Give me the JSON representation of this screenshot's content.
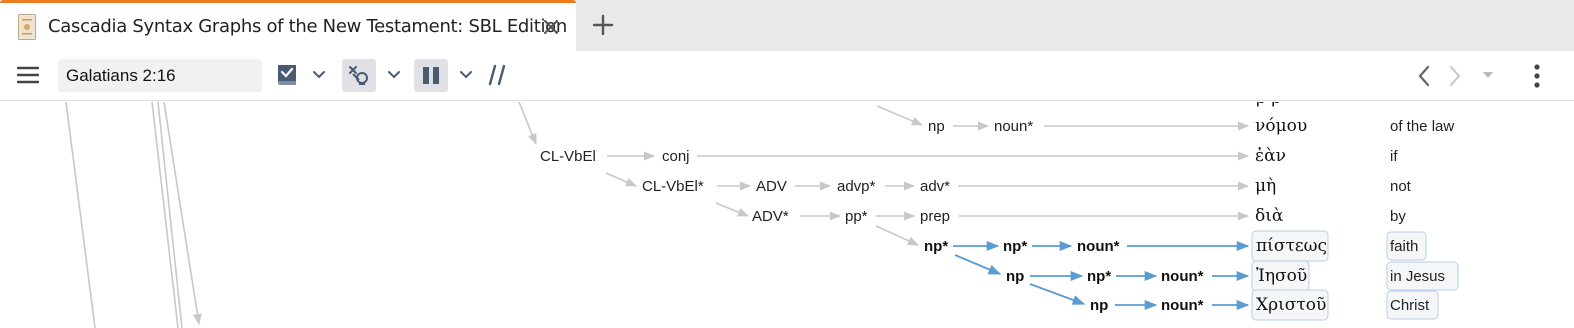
{
  "tab": {
    "title": "Cascadia Syntax Graphs of the New Testament: SBL Edition",
    "close_icon": "close-icon"
  },
  "new_tab_icon": "plus-icon",
  "toolbar": {
    "menu_icon": "hamburger-menu-icon",
    "reference": "Galatians 2:16",
    "buttons": [
      "checklist-icon",
      "chevron-down-icon",
      "link-search-icon",
      "chevron-down-icon",
      "pause-columns-icon",
      "chevron-down-icon",
      "parallel-lines-icon"
    ],
    "nav": [
      "back-icon",
      "forward-icon",
      "chevron-down-icon",
      "more-vertical-icon"
    ]
  },
  "graph": {
    "rows": [
      {
        "greek": "νόμου",
        "gloss": "of the law"
      },
      {
        "greek": "ἐὰν",
        "gloss": "if"
      },
      {
        "greek": "μὴ",
        "gloss": "not"
      },
      {
        "greek": "διὰ",
        "gloss": "by"
      },
      {
        "greek": "πίστεως",
        "gloss": "faith"
      },
      {
        "greek": "Ἰησοῦ",
        "gloss": "in Jesus"
      },
      {
        "greek": "Χριστοῦ",
        "gloss": "Christ"
      }
    ],
    "nodes": {
      "r0_np": "np",
      "r0_noun": "noun*",
      "r1_clv": "CL-VbEl",
      "r1_conj": "conj",
      "r2_clv": "CL-VbEl*",
      "r2_adv": "ADV",
      "r2_advp": "advp*",
      "r2_adv2": "adv*",
      "r3_adv": "ADV*",
      "r3_pp": "pp*",
      "r3_prep": "prep",
      "r4_np1": "np*",
      "r4_np2": "np*",
      "r4_noun": "noun*",
      "r5_np": "np",
      "r5_np2": "np*",
      "r5_noun": "noun*",
      "r6_np": "np",
      "r6_noun": "noun*"
    },
    "colors": {
      "gray_arrow": "#c8c8c8",
      "blue_arrow": "#5a9bd1"
    }
  }
}
